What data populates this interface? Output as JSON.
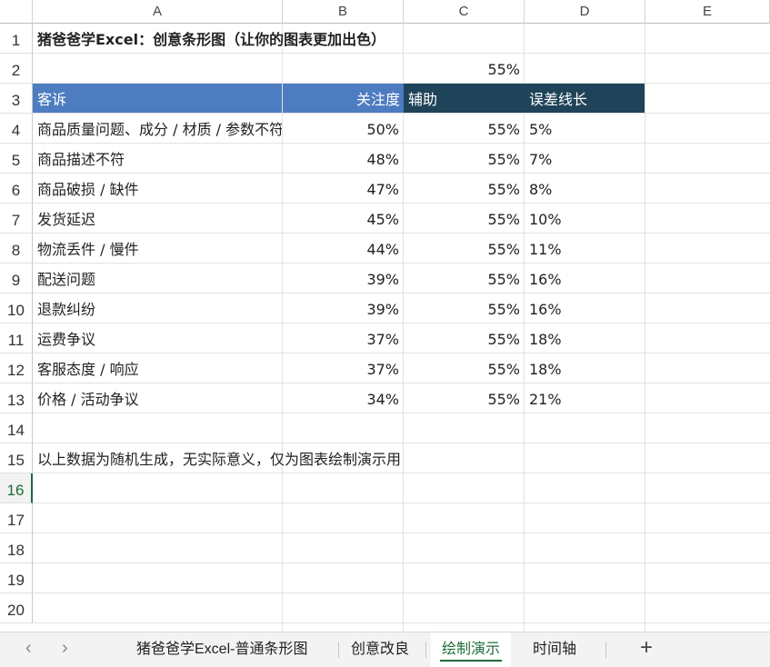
{
  "columns": [
    "A",
    "B",
    "C",
    "D",
    "E"
  ],
  "rows": [
    "1",
    "2",
    "3",
    "4",
    "5",
    "6",
    "7",
    "8",
    "9",
    "10",
    "11",
    "12",
    "13",
    "14",
    "15",
    "16",
    "17",
    "18",
    "19",
    "20"
  ],
  "active_row": "16",
  "title": "猪爸爸学Excel：创意条形图（让你的图表更加出色）",
  "c2_value": "55%",
  "headers": {
    "a": "客诉",
    "b": "关注度",
    "c": "辅助",
    "d": "误差线长"
  },
  "table_rows": [
    {
      "name": "商品质量问题、成分 / 材质 / 参数不符",
      "attention": "50%",
      "helper": "55%",
      "error": "5%"
    },
    {
      "name": "商品描述不符",
      "attention": "48%",
      "helper": "55%",
      "error": "7%"
    },
    {
      "name": "商品破损 / 缺件",
      "attention": "47%",
      "helper": "55%",
      "error": "8%"
    },
    {
      "name": "发货延迟",
      "attention": "45%",
      "helper": "55%",
      "error": "10%"
    },
    {
      "name": "物流丢件 / 慢件",
      "attention": "44%",
      "helper": "55%",
      "error": "11%"
    },
    {
      "name": "配送问题",
      "attention": "39%",
      "helper": "55%",
      "error": "16%"
    },
    {
      "name": "退款纠纷",
      "attention": "39%",
      "helper": "55%",
      "error": "16%"
    },
    {
      "name": "运费争议",
      "attention": "37%",
      "helper": "55%",
      "error": "18%"
    },
    {
      "name": "客服态度 / 响应",
      "attention": "37%",
      "helper": "55%",
      "error": "18%"
    },
    {
      "name": "价格 / 活动争议",
      "attention": "34%",
      "helper": "55%",
      "error": "21%"
    }
  ],
  "note": "以上数据为随机生成，无实际意义，仅为图表绘制演示用",
  "tabs": [
    {
      "label": "猪爸爸学Excel-普通条形图",
      "active": false
    },
    {
      "label": "创意改良",
      "active": false
    },
    {
      "label": "绘制演示",
      "active": true
    },
    {
      "label": "时间轴",
      "active": false
    }
  ],
  "nav": {
    "prev_icon": "‹",
    "next_icon": "›",
    "add_icon": "+"
  },
  "colors": {
    "header_blue": "#4e7cc0",
    "header_dark": "#1f4358",
    "accent_green": "#1e6b3a"
  }
}
